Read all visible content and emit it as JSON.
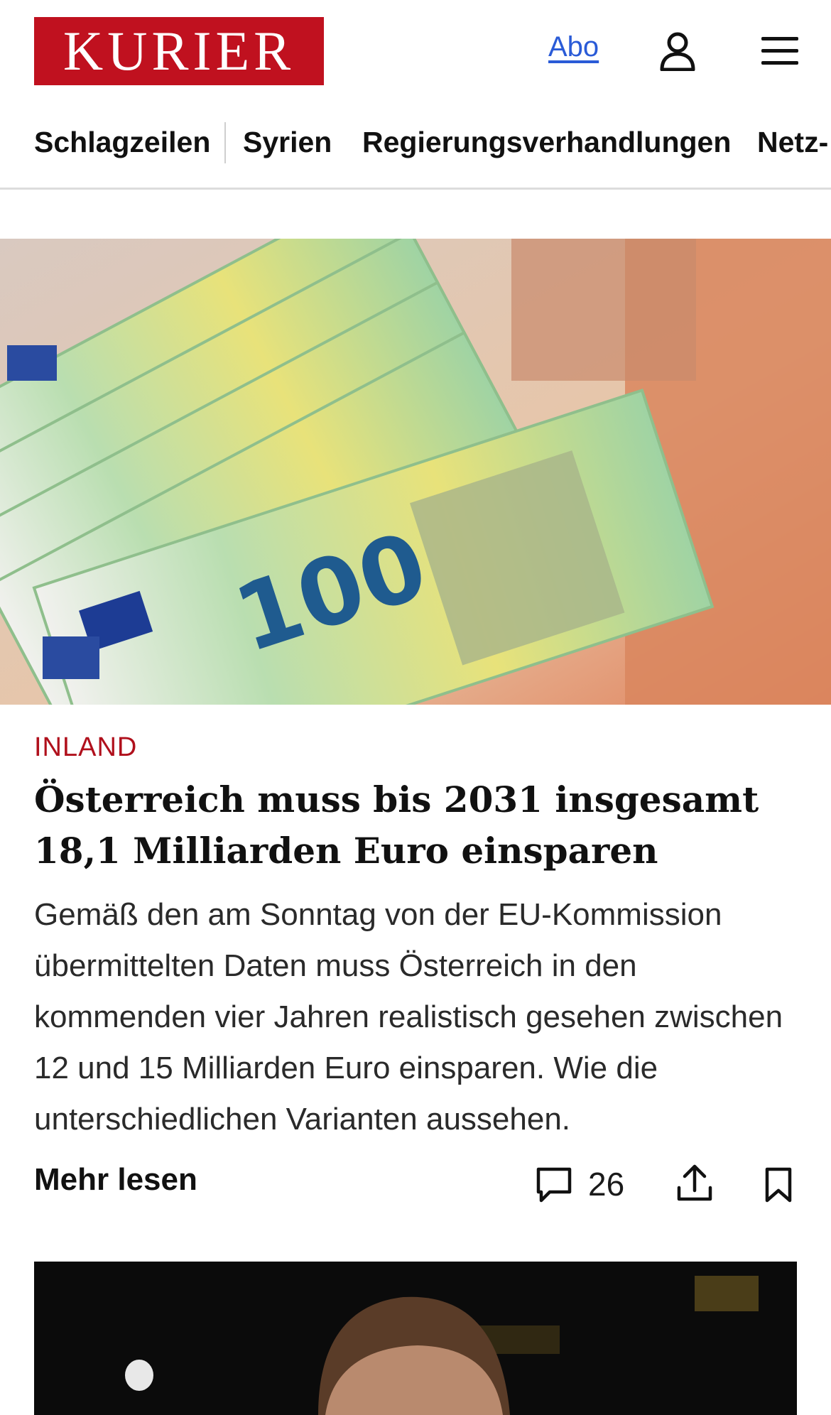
{
  "header": {
    "logo_text": "KURIER",
    "abo_label": "Abo",
    "user_icon": "user-icon",
    "menu_icon": "hamburger-menu-icon"
  },
  "nav": {
    "items": [
      "Schlagzeilen",
      "Syrien",
      "Regierungsverhandlungen",
      "Netz-"
    ]
  },
  "article": {
    "kicker": "INLAND",
    "headline": "Österreich muss bis 2031 insgesamt 18,1 Milliarden Euro einsparen",
    "teaser": "Gemäß den am Sonntag von der EU-Kommission übermittelten Daten muss Österreich in den kommenden vier Jahren realistisch gesehen zwischen 12 und 15 Milliarden Euro einsparen. Wie die unterschiedlichen Varianten aussehen.",
    "more_label": "Mehr lesen",
    "comment_count": "26",
    "comment_icon": "comment-icon",
    "share_icon": "share-icon",
    "bookmark_icon": "bookmark-icon"
  },
  "colors": {
    "brand": "#c0111f",
    "link": "#2a5bd7",
    "kicker": "#b0101c"
  }
}
